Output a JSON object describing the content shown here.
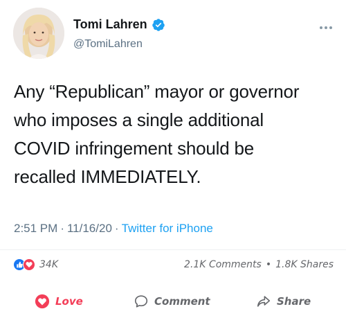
{
  "tweet": {
    "display_name": "Tomi Lahren",
    "handle": "@TomiLahren",
    "text": "Any “Republican” mayor or governor\nwho imposes a single additional\nCOVID infringement should be\nrecalled IMMEDIATELY.",
    "time": "2:51 PM",
    "date": "11/16/20",
    "source": "Twitter for iPhone",
    "separator": "·"
  },
  "reactions": {
    "count": "34K",
    "comments": "2.1K Comments",
    "shares": "1.8K Shares",
    "dot": "•"
  },
  "actions": {
    "love": "Love",
    "comment": "Comment",
    "share": "Share"
  },
  "colors": {
    "link": "#1da1f2",
    "love": "#f33e58",
    "like": "#1877f2",
    "verified": "#1da1f2"
  }
}
